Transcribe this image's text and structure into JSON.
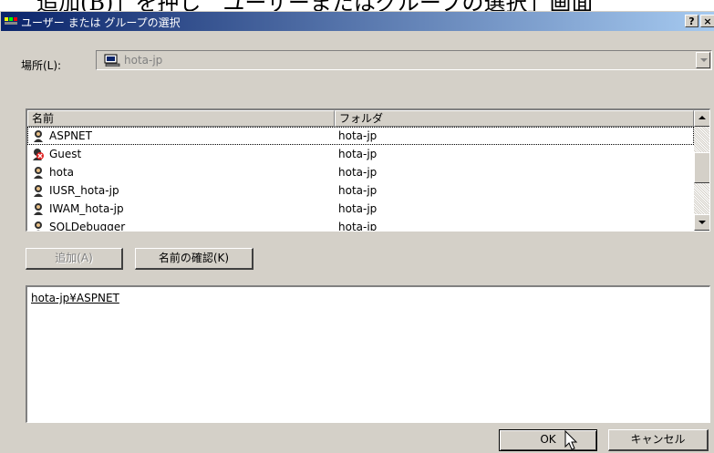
{
  "background_text": "追加(B)」を押し　ユーザーまたはグループの選択」画面",
  "dialog": {
    "title": "ユーザー または グループの選択",
    "help_label": "?",
    "close_label": "×"
  },
  "location": {
    "label": "場所(L):",
    "value": "hota-jp"
  },
  "list": {
    "columns": [
      "名前",
      "フォルダ"
    ],
    "rows": [
      {
        "name": "ASPNET",
        "folder": "hota-jp",
        "icon": "user-icon"
      },
      {
        "name": "Guest",
        "folder": "hota-jp",
        "icon": "disabled-user-icon"
      },
      {
        "name": "hota",
        "folder": "hota-jp",
        "icon": "user-icon"
      },
      {
        "name": "IUSR_hota-jp",
        "folder": "hota-jp",
        "icon": "user-icon"
      },
      {
        "name": "IWAM_hota-jp",
        "folder": "hota-jp",
        "icon": "user-icon"
      },
      {
        "name": "SQLDebugger",
        "folder": "hota-jp",
        "icon": "user-icon"
      }
    ]
  },
  "buttons": {
    "add": "追加(A)",
    "check_names": "名前の確認(K)",
    "ok": "OK",
    "cancel": "キャンセル"
  },
  "selected": {
    "value": "hota-jp¥ASPNET"
  },
  "colors": {
    "title_start": "#0a246a",
    "title_end": "#a6caf0",
    "face": "#d4d0c8"
  }
}
